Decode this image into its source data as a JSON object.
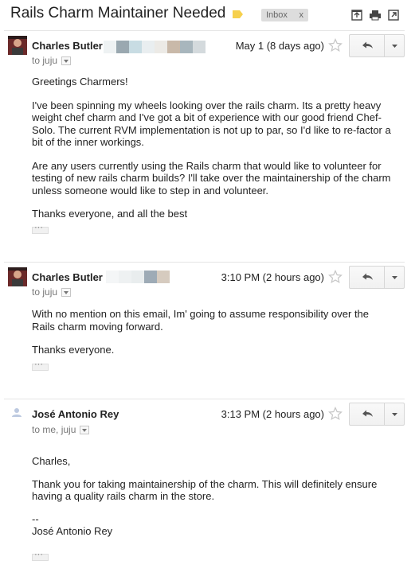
{
  "thread": {
    "subject": "Rails Charm Maintainer Needed",
    "label": "Inbox",
    "label_remove": "x",
    "label_color": "#f6d04d"
  },
  "messages": [
    {
      "sender": "Charles Butler",
      "date": "May 1 (8 days ago)",
      "recipients_prefix": "to",
      "recipients": "juju",
      "body": [
        "Greetings Charmers!",
        "I've been spinning my wheels looking over the rails charm. Its a pretty heavy weight chef charm and I've got a bit of experience with our good friend Chef-Solo. The current RVM implementation is not up to par, so I'd like to re-factor a bit of the inner workings.",
        "Are any users currently using the Rails charm that would like to volunteer for testing of new rails charm builds? I'll take over the maintainership of the charm unless someone would like to step in and volunteer.",
        "Thanks everyone, and all the best"
      ]
    },
    {
      "sender": "Charles Butler",
      "date": "3:10 PM (2 hours ago)",
      "recipients_prefix": "to",
      "recipients": "juju",
      "body": [
        "With no mention on this email, Im' going to assume responsibility over the Rails charm moving forward.",
        "Thanks everyone."
      ]
    },
    {
      "sender": "José Antonio Rey",
      "date": "3:13 PM (2 hours ago)",
      "recipients_prefix": "to",
      "recipients": "me, juju",
      "body": [
        "Charles,",
        "Thank you for taking maintainership of the charm. This will definitely ensure having a quality rails charm in the store.",
        "--",
        "José Antonio Rey"
      ]
    }
  ]
}
